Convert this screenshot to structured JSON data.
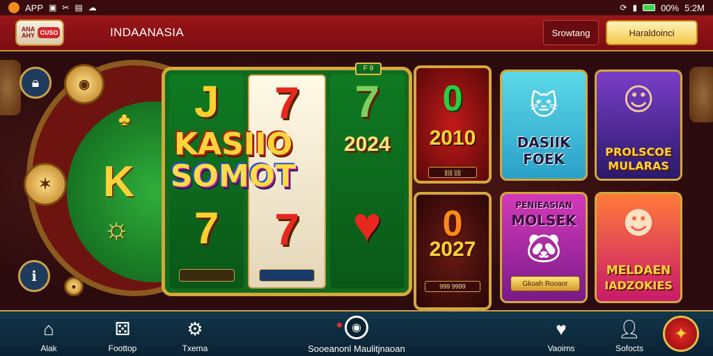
{
  "status_bar": {
    "app_label": "APP",
    "battery_text": "00%",
    "time": "5:2M",
    "icons": [
      "app-dot-icon",
      "screenshot-icon",
      "tools-icon",
      "media-icon",
      "cloud-icon",
      "sync-icon",
      "signal-icon",
      "battery-icon"
    ]
  },
  "header": {
    "logo_text_a": "ANA AHY",
    "logo_text_b": "CUSO",
    "title": "INDAANASIA",
    "secondary_button": "Srowtang",
    "primary_button": "Haraldoinci"
  },
  "slot": {
    "badge": "F 9",
    "title_line1": "KASIIO",
    "title_line2": "SOMOT",
    "felt_letter": "K",
    "reels": [
      {
        "top": "J",
        "mid": "",
        "bottom": "7",
        "label": ""
      },
      {
        "top": "7",
        "mid": "",
        "bottom": "7",
        "label": ""
      },
      {
        "top": "7",
        "mid": "2024",
        "bottom": "",
        "label": ""
      }
    ]
  },
  "jackpots": [
    {
      "big": "0",
      "year": "2010",
      "label": "||||| ||||"
    },
    {
      "big": "0",
      "year": "2027",
      "label": "999 9999"
    }
  ],
  "cards": [
    {
      "title_line1": "DASIIK",
      "title_line2": "FOEK"
    },
    {
      "title_line1": "PROLSCOE",
      "title_line2": "MULARAS"
    },
    {
      "title_line1": "PENIEASIAN",
      "title_line2": "MOLSEK",
      "button": "Gkoah Rooaor"
    },
    {
      "title_line1": "MELDAEN",
      "title_line2": "IADZOKIES"
    }
  ],
  "bottom_nav": {
    "items": [
      {
        "label": "Alak",
        "icon": "home-icon"
      },
      {
        "label": "Foottop",
        "icon": "puzzle-icon"
      },
      {
        "label": "Txema",
        "icon": "gear-icon"
      },
      {
        "label": "Vaoims",
        "icon": "heart-icon"
      },
      {
        "label": "Sofocts",
        "icon": "user-icon"
      }
    ],
    "center_label": "Sooeanonl Maulitjnaoan",
    "center_icon": "location-icon",
    "fab_icon": "star-icon"
  },
  "colors": {
    "header_red": "#9a1618",
    "gold": "#d4a83a",
    "nav_blue": "#12364a",
    "felt_green": "#2fae3a"
  }
}
